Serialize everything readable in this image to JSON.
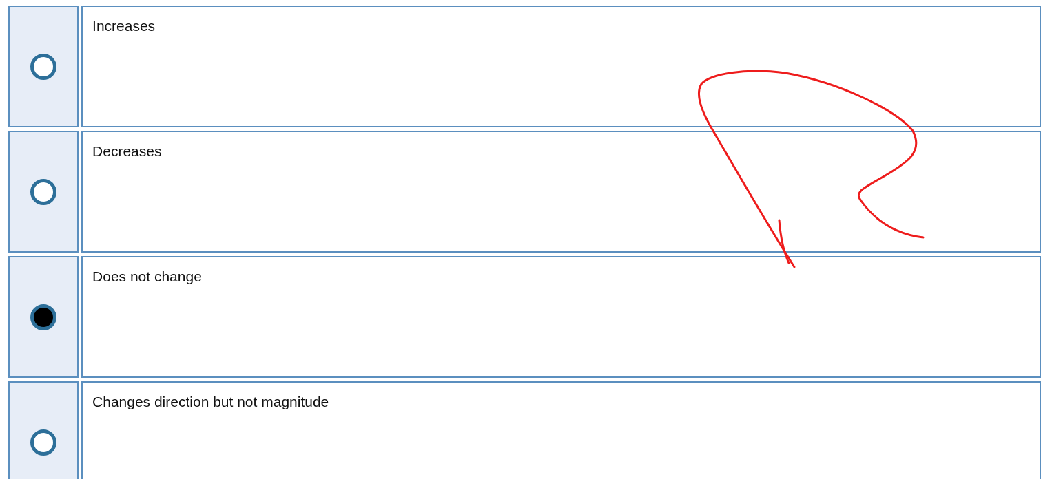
{
  "options": [
    {
      "label": "Increases",
      "selected": false
    },
    {
      "label": "Decreases",
      "selected": false
    },
    {
      "label": "Does not change",
      "selected": true
    },
    {
      "label": "Changes direction but not magnitude",
      "selected": false
    }
  ]
}
